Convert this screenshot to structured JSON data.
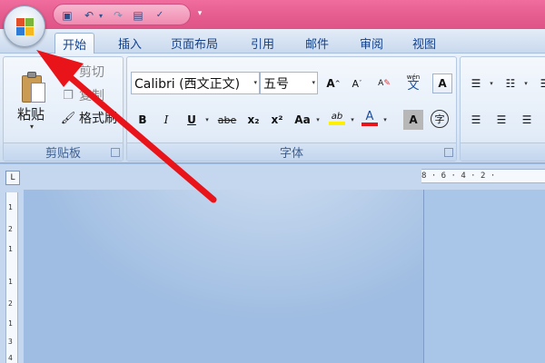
{
  "quick_access": {
    "items": [
      "save-icon",
      "undo-icon",
      "redo-icon",
      "print-preview-icon",
      "spelling-icon"
    ],
    "more_label": "▾"
  },
  "tabs": [
    {
      "label": "开始",
      "active": true
    },
    {
      "label": "插入"
    },
    {
      "label": "页面布局"
    },
    {
      "label": "引用"
    },
    {
      "label": "邮件"
    },
    {
      "label": "审阅"
    },
    {
      "label": "视图"
    }
  ],
  "clipboard": {
    "paste_label": "粘贴",
    "cut_label": "剪切",
    "copy_label": "复制",
    "format_painter_label": "格式刷",
    "group_label": "剪贴板"
  },
  "font": {
    "font_name": "Calibri (西文正文)",
    "font_size": "五号",
    "bold": "B",
    "italic": "I",
    "underline": "U",
    "strikethrough": "abe",
    "subscript": "x₂",
    "superscript": "x²",
    "change_case": "Aa",
    "highlight": "ab",
    "font_color": "A",
    "char_shading": "A",
    "enclose": "字",
    "grow": "A",
    "shrink": "A",
    "clear": "A",
    "phonetic": "wén",
    "phonetic_char": "文",
    "border": "A",
    "group_label": "字体"
  },
  "ruler": {
    "corner": "L",
    "h_marks": "8 · 6 · 4 · 2 · ",
    "v_marks": [
      "1",
      "2",
      "1",
      "1",
      "2",
      "1",
      "3",
      "4"
    ]
  },
  "colors": {
    "title_bar": "#e45b8d",
    "accent_text": "#15428b",
    "arrow": "#e8141a"
  }
}
